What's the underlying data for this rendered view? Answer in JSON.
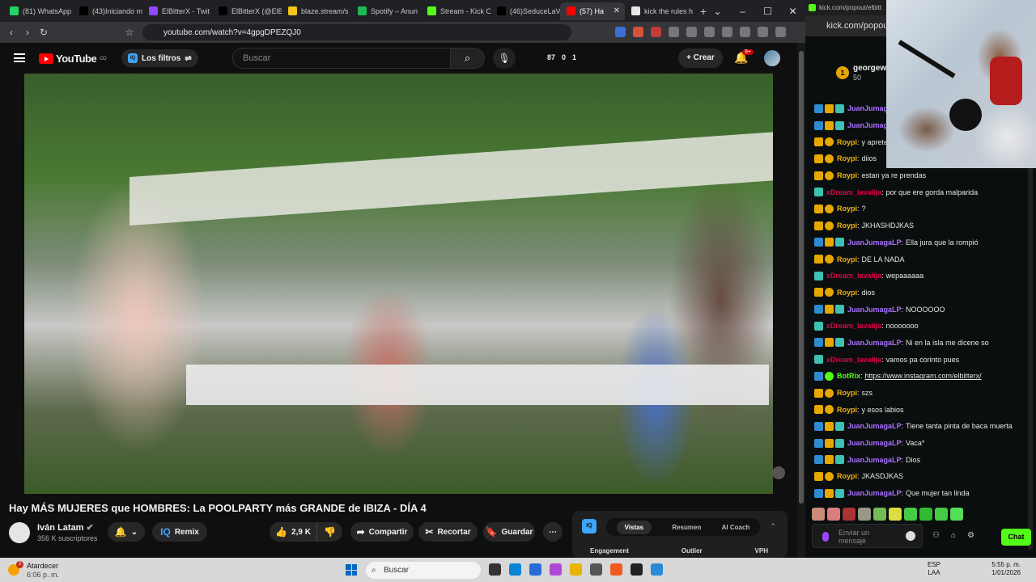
{
  "browser": {
    "tabs": [
      {
        "label": "(81) WhatsApp",
        "color": "#25d366"
      },
      {
        "label": "(43)Iniciando m",
        "color": "#000000"
      },
      {
        "label": "ElBitterX - Twit",
        "color": "#9146ff"
      },
      {
        "label": "ElBitterX (@ElB",
        "color": "#000000"
      },
      {
        "label": "blaze.stream/s",
        "color": "#f5c518"
      },
      {
        "label": "Spotify – Anun",
        "color": "#1db954"
      },
      {
        "label": "Stream - Kick C",
        "color": "#53fc18"
      },
      {
        "label": "(46)SeduceLaV",
        "color": "#000000"
      },
      {
        "label": "(57) Ha",
        "color": "#ff0000",
        "active": true
      },
      {
        "label": "kick the rules h",
        "color": "#e8e8e8"
      }
    ],
    "url": "youtube.com/watch?v=4gpgDPEZQJ0"
  },
  "youtube": {
    "logo": "YouTube",
    "country": "CO",
    "filters_label": "Los filtros",
    "search_placeholder": "Buscar",
    "stats": [
      "87",
      "0",
      "1"
    ],
    "create_label": "Crear",
    "notifications": "9+",
    "video_title": "Hay MÁS MUJERES que HOMBRES: La POOLPARTY más GRANDE de IBIZA - DÍA 4",
    "channel_name": "Iván Latam",
    "subscribers": "356 K suscriptores",
    "remix_label": "Remix",
    "likes": "2,9 K",
    "share_label": "Compartir",
    "clip_label": "Recortar",
    "save_label": "Guardar",
    "vidiq": {
      "logo": "IQ",
      "tabs": [
        "Vistas",
        "Resumen",
        "AI Coach"
      ],
      "metrics": [
        "Engagement",
        "Outlier",
        "VPH"
      ]
    }
  },
  "kick": {
    "titlebar": "kick.com/popout/elbitt",
    "url": "kick.com/popout/",
    "pinned_user": "georgew",
    "pinned_amount": "50",
    "messages": [
      {
        "badges": [
          "mod",
          "crown",
          "vip"
        ],
        "user": "JuanJumagaLP",
        "color": "#a970ff",
        "text": ""
      },
      {
        "badges": [
          "mod",
          "crown",
          "vip"
        ],
        "user": "JuanJumagaLP",
        "color": "#a970ff",
        "text": ""
      },
      {
        "badges": [
          "crown",
          "sub"
        ],
        "user": "Roypi",
        "color": "#f0b400",
        "text": "y aprete"
      },
      {
        "badges": [
          "crown",
          "sub"
        ],
        "user": "Roypi",
        "color": "#f0b400",
        "text": "diios"
      },
      {
        "badges": [
          "crown",
          "sub"
        ],
        "user": "Roypi",
        "color": "#f0b400",
        "text": "estan ya re prendas"
      },
      {
        "badges": [
          "vip"
        ],
        "user": "xDream_lavalija",
        "color": "#e0004c",
        "text": "por que ere gorda malparida"
      },
      {
        "badges": [
          "crown",
          "sub"
        ],
        "user": "Roypi",
        "color": "#f0b400",
        "text": "?"
      },
      {
        "badges": [
          "crown",
          "sub"
        ],
        "user": "Roypi",
        "color": "#f0b400",
        "text": "JKHASHDJKAS"
      },
      {
        "badges": [
          "mod",
          "crown",
          "vip"
        ],
        "user": "JuanJumagaLP",
        "color": "#a970ff",
        "text": "Ella jura que la rompió"
      },
      {
        "badges": [
          "crown",
          "sub"
        ],
        "user": "Roypi",
        "color": "#f0b400",
        "text": "DE LA NADA"
      },
      {
        "badges": [
          "vip"
        ],
        "user": "xDream_lavalija",
        "color": "#e0004c",
        "text": "wepaaaaaa"
      },
      {
        "badges": [
          "crown",
          "sub"
        ],
        "user": "Roypi",
        "color": "#f0b400",
        "text": "dios"
      },
      {
        "badges": [
          "mod",
          "crown",
          "vip"
        ],
        "user": "JuanJumagaLP",
        "color": "#a970ff",
        "text": "NOOOOOO"
      },
      {
        "badges": [
          "vip"
        ],
        "user": "xDream_lavalija",
        "color": "#e0004c",
        "text": "nooooooo"
      },
      {
        "badges": [
          "mod",
          "crown",
          "vip"
        ],
        "user": "JuanJumagaLP",
        "color": "#a970ff",
        "text": "Ni en la isla me dicene so"
      },
      {
        "badges": [
          "vip"
        ],
        "user": "xDream_lavalija",
        "color": "#e0004c",
        "text": "vamos pa corinto pues"
      },
      {
        "badges": [
          "mod",
          "bot"
        ],
        "user": "BotRix",
        "color": "#53fc18",
        "text": "https://www.instagram.com/elbitterx/",
        "link": true
      },
      {
        "badges": [
          "crown",
          "sub"
        ],
        "user": "Roypi",
        "color": "#f0b400",
        "text": "szs"
      },
      {
        "badges": [
          "crown",
          "sub"
        ],
        "user": "Roypi",
        "color": "#f0b400",
        "text": "y esos labios"
      },
      {
        "badges": [
          "mod",
          "crown",
          "vip"
        ],
        "user": "JuanJumagaLP",
        "color": "#a970ff",
        "text": "Tiene tanta pinta de baca muerta"
      },
      {
        "badges": [
          "mod",
          "crown",
          "vip"
        ],
        "user": "JuanJumagaLP",
        "color": "#a970ff",
        "text": "Vaca*"
      },
      {
        "badges": [
          "mod",
          "crown",
          "vip"
        ],
        "user": "JuanJumagaLP",
        "color": "#a970ff",
        "text": "Dios"
      },
      {
        "badges": [
          "crown",
          "sub"
        ],
        "user": "Roypi",
        "color": "#f0b400",
        "text": "JKASDJKAS"
      },
      {
        "badges": [
          "mod",
          "crown",
          "vip"
        ],
        "user": "JuanJumagaLP",
        "color": "#a970ff",
        "text": "Que mujer tan linda"
      }
    ],
    "input_placeholder": "Enviar un mensaje",
    "chat_button": "Chat"
  },
  "taskbar": {
    "weather_label": "Atardecer",
    "weather_time": "6:06 p. m.",
    "weather_badge": "2",
    "search_placeholder": "Buscar",
    "lang_1": "ESP",
    "lang_2": "LAA",
    "time": "5:55 p. m.",
    "date": "1/01/2026"
  }
}
